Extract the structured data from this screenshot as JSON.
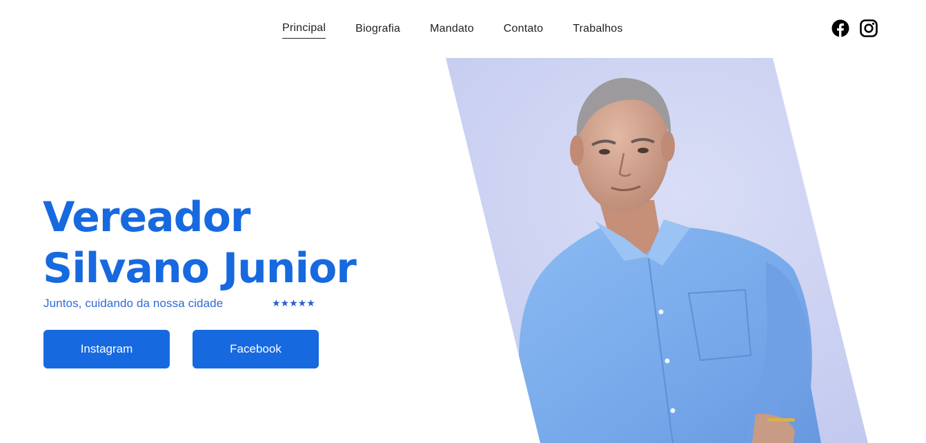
{
  "nav": {
    "items": [
      {
        "label": "Principal",
        "active": true
      },
      {
        "label": "Biografia",
        "active": false
      },
      {
        "label": "Mandato",
        "active": false
      },
      {
        "label": "Contato",
        "active": false
      },
      {
        "label": "Trabalhos",
        "active": false
      }
    ]
  },
  "social": {
    "icons": [
      "facebook-icon",
      "instagram-icon"
    ]
  },
  "hero": {
    "title_line1": "Vereador",
    "title_line2": "Silvano Junior",
    "tagline": "Juntos, cuidando da nossa cidade",
    "stars": "★★★★★",
    "buttons": {
      "instagram": "Instagram",
      "facebook": "Facebook"
    }
  },
  "colors": {
    "brand_blue": "#1769e0",
    "tagline_blue": "#2f6ad6",
    "photo_background": "#c9cff0",
    "shirt_blue": "#7fb0ee"
  }
}
